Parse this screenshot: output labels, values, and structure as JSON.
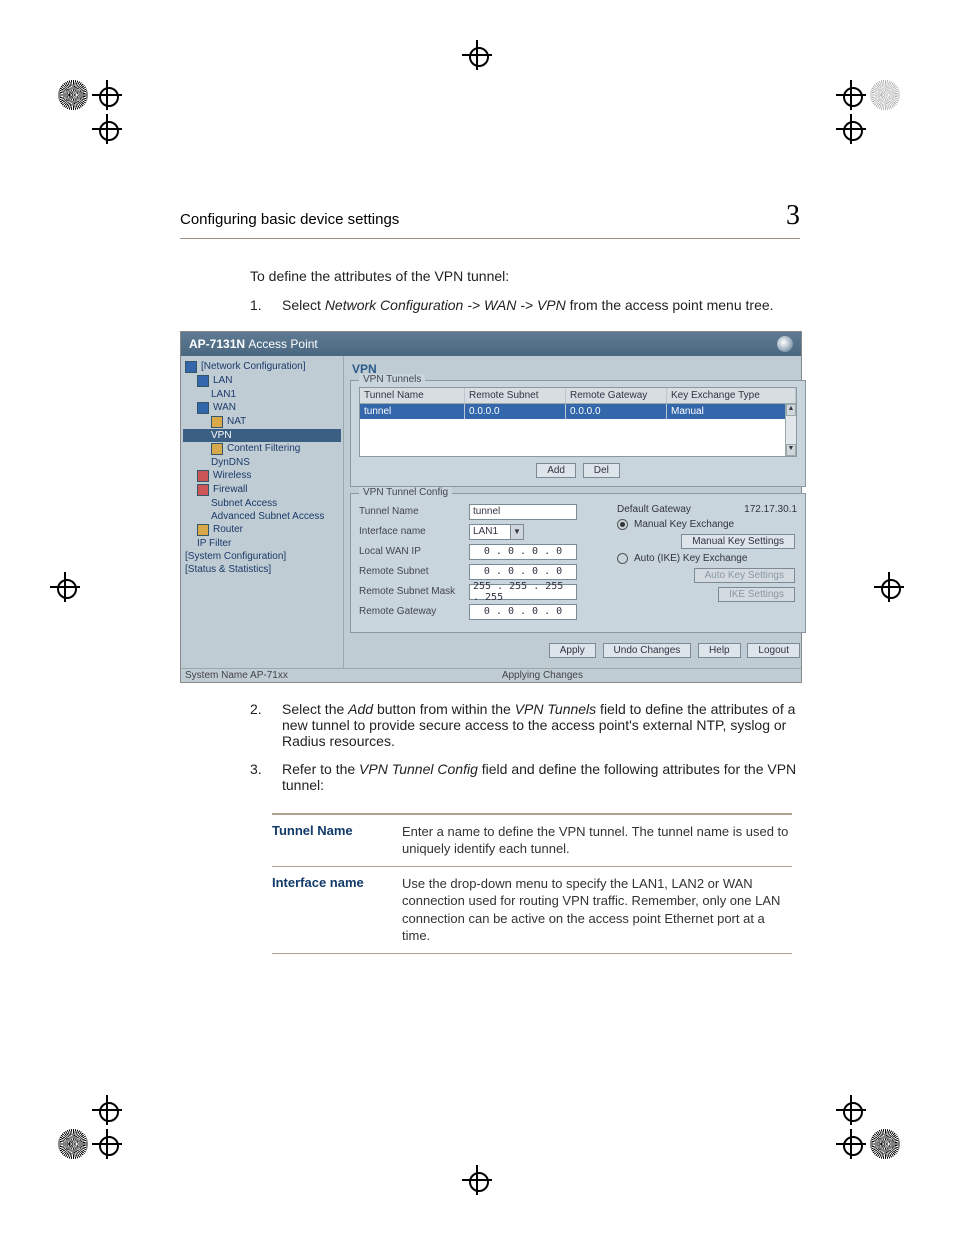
{
  "header": {
    "title": "Configuring basic device settings",
    "chapter": "3"
  },
  "intro": "To define the attributes of the VPN tunnel:",
  "step1": {
    "n": "1.",
    "pre": "Select ",
    "path": "Network Configuration -> WAN -> VPN",
    "post": " from the access point menu tree."
  },
  "step2": {
    "n": "2.",
    "text_pre": "Select the ",
    "em1": "Add",
    "mid1": " button from within the ",
    "em2": "VPN Tunnels",
    "mid2": " field to define the attributes of a new tunnel to provide secure access to the access point's external NTP, syslog or Radius resources."
  },
  "step3": {
    "n": "3.",
    "pre": "Refer to the ",
    "em": "VPN Tunnel Config",
    "post": " field and define the following attributes for the VPN tunnel:"
  },
  "shot": {
    "title_prefix": "AP-7131N ",
    "title_suffix": "Access Point",
    "tree": [
      {
        "label": "[Network Configuration]",
        "cls": "",
        "icon": "blue"
      },
      {
        "label": "LAN",
        "cls": "indent1",
        "icon": "blue"
      },
      {
        "label": "LAN1",
        "cls": "indent2",
        "icon": ""
      },
      {
        "label": "WAN",
        "cls": "indent1",
        "icon": "blue"
      },
      {
        "label": "NAT",
        "cls": "indent2",
        "icon": "folder"
      },
      {
        "label": "VPN",
        "cls": "indent2 selected",
        "icon": ""
      },
      {
        "label": "Content Filtering",
        "cls": "indent2",
        "icon": "folder"
      },
      {
        "label": "DynDNS",
        "cls": "indent2",
        "icon": ""
      },
      {
        "label": "Wireless",
        "cls": "indent1",
        "icon": "red"
      },
      {
        "label": "Firewall",
        "cls": "indent1",
        "icon": "red"
      },
      {
        "label": "Subnet Access",
        "cls": "indent2",
        "icon": ""
      },
      {
        "label": "Advanced Subnet Access",
        "cls": "indent2",
        "icon": ""
      },
      {
        "label": "Router",
        "cls": "indent1",
        "icon": "folder"
      },
      {
        "label": "IP Filter",
        "cls": "indent1",
        "icon": ""
      },
      {
        "label": "[System Configuration]",
        "cls": "",
        "icon": ""
      },
      {
        "label": "[Status & Statistics]",
        "cls": "",
        "icon": ""
      }
    ],
    "section": "VPN",
    "tunnels_legend": "VPN Tunnels",
    "grid": {
      "headers": [
        "Tunnel Name",
        "Remote Subnet",
        "Remote Gateway",
        "Key Exchange Type"
      ],
      "row": [
        "tunnel",
        "0.0.0.0",
        "0.0.0.0",
        "Manual"
      ],
      "col_w": [
        "96px",
        "92px",
        "92px",
        "120px"
      ]
    },
    "add": "Add",
    "del": "Del",
    "config_legend": "VPN Tunnel Config",
    "cfg": {
      "tunnel_name_lbl": "Tunnel Name",
      "tunnel_name": "tunnel",
      "iface_lbl": "Interface name",
      "iface": "LAN1",
      "local_wan_lbl": "Local WAN IP",
      "local_wan": "0 . 0 . 0 . 0",
      "remote_subnet_lbl": "Remote Subnet",
      "remote_subnet": "0 . 0 . 0 . 0",
      "remote_mask_lbl": "Remote Subnet Mask",
      "remote_mask": "255 . 255 . 255 . 255",
      "remote_gw_lbl": "Remote Gateway",
      "remote_gw": "0 . 0 . 0 . 0",
      "def_gw_lbl": "Default Gateway",
      "def_gw": "172.17.30.1",
      "manual_radio": "Manual Key Exchange",
      "manual_btn": "Manual Key Settings",
      "auto_radio": "Auto (IKE) Key Exchange",
      "auto_btn": "Auto Key Settings",
      "ike_btn": "IKE Settings"
    },
    "footer": [
      "Apply",
      "Undo Changes",
      "Help",
      "Logout"
    ],
    "status_left": "System Name AP-71xx",
    "status_center": "Applying Changes"
  },
  "attrs": [
    {
      "name": "Tunnel Name",
      "desc": "Enter a name to define the VPN tunnel. The tunnel name is used to uniquely identify each tunnel."
    },
    {
      "name": "Interface name",
      "desc": "Use the drop-down menu to specify the LAN1, LAN2 or WAN connection used for routing VPN traffic. Remember, only one LAN connection can be active on the access point Ethernet port at a time."
    }
  ]
}
